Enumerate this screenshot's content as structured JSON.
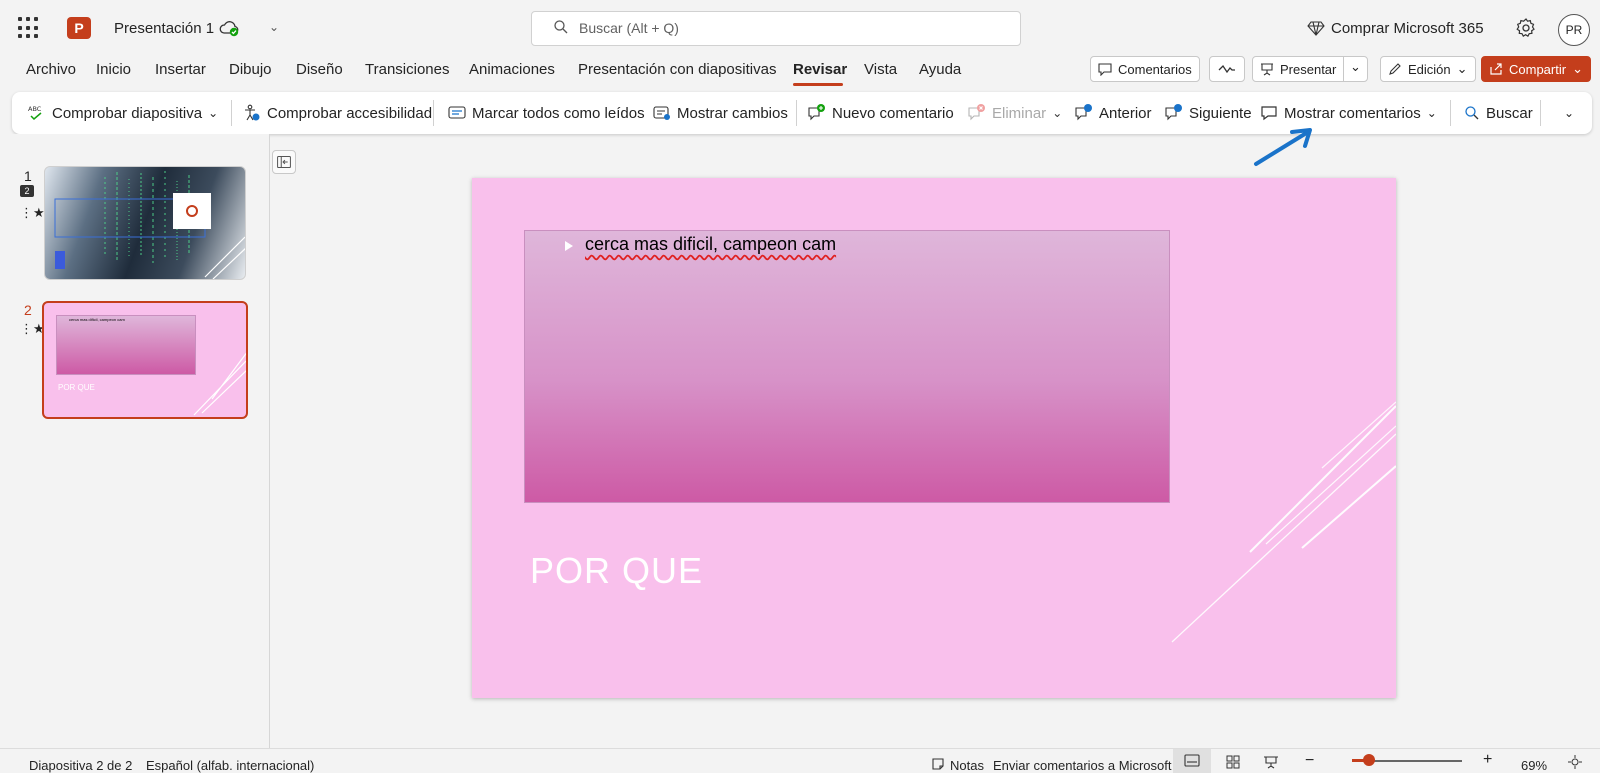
{
  "titlebar": {
    "app_logo": "P",
    "doc_title": "Presentación 1",
    "search_placeholder": "Buscar (Alt + Q)",
    "buy_label": "Comprar Microsoft 365",
    "avatar_initials": "PR"
  },
  "menu": {
    "tabs": [
      "Archivo",
      "Inicio",
      "Insertar",
      "Dibujo",
      "Diseño",
      "Transiciones",
      "Animaciones",
      "Presentación con diapositivas",
      "Revisar",
      "Vista",
      "Ayuda"
    ],
    "active_tab": "Revisar",
    "comments_label": "Comentarios",
    "present_label": "Presentar",
    "edit_label": "Edición",
    "share_label": "Compartir"
  },
  "ribbon": {
    "check_slide": "Comprobar diapositiva",
    "check_accessibility": "Comprobar accesibilidad",
    "mark_all_read": "Marcar todos como leídos",
    "show_changes": "Mostrar cambios",
    "new_comment": "Nuevo comentario",
    "delete": "Eliminar",
    "previous": "Anterior",
    "next": "Siguiente",
    "show_comments": "Mostrar comentarios",
    "search": "Buscar"
  },
  "thumbnails": [
    {
      "number": "1",
      "comment_count": "2"
    },
    {
      "number": "2",
      "thumb_bullet": "cerca mas dificil, campeon cam",
      "thumb_title": "POR QUE"
    }
  ],
  "slide": {
    "bullet": "cerca mas dificil, campeon cam",
    "title": "POR QUE"
  },
  "statusbar": {
    "slide_counter": "Diapositiva 2 de 2",
    "language": "Español (alfab. internacional)",
    "notes": "Notas",
    "feedback": "Enviar comentarios a Microsoft",
    "zoom": "69%",
    "zoom_level": 0.15
  },
  "colors": {
    "accent": "#c43e1c",
    "slide_background": "#f9c0ec",
    "arrow": "#1a73c9"
  }
}
